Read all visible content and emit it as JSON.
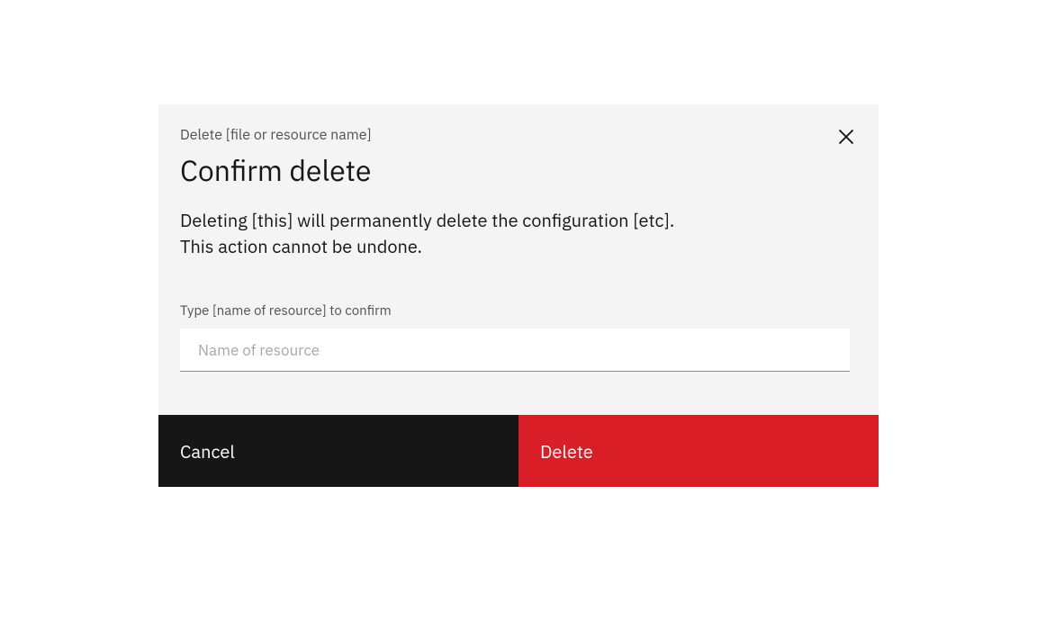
{
  "modal": {
    "label": "Delete [file or resource name]",
    "title": "Confirm delete",
    "description": "Deleting [this] will permanently delete the configuration [etc]. This action cannot be undone.",
    "input": {
      "label": "Type [name of resource] to confirm",
      "placeholder": "Name of resource"
    },
    "buttons": {
      "cancel": "Cancel",
      "delete": "Delete"
    }
  }
}
